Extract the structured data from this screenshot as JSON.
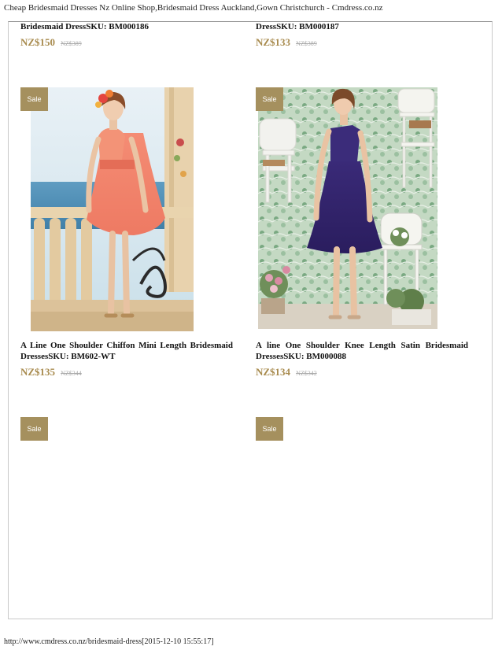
{
  "print": {
    "header_title": "Cheap Bridesmaid Dresses Nz Online Shop,Bridesmaid Dress Auckland,Gown Christchurch - Cmdress.co.nz",
    "footer_url": "http://www.cmdress.co.nz/bridesmaid-dress[2015-12-10 15:55:17]"
  },
  "products_top": [
    {
      "title": "Bridesmaid DressSKU: BM000186",
      "price": "NZ$150",
      "old_price": "NZ$389"
    },
    {
      "title": "DressSKU: BM000187",
      "price": "NZ$133",
      "old_price": "NZ$389"
    }
  ],
  "products_mid": [
    {
      "badge": "Sale",
      "image_alt": "Coral one shoulder chiffon mini dress",
      "title": "A Line One Shoulder Chiffon Mini Length Bridesmaid DressesSKU: BM602-WT",
      "price": "NZ$135",
      "old_price": "NZ$344"
    },
    {
      "badge": "Sale",
      "image_alt": "Purple one shoulder satin knee length dress",
      "title": "A line One Shoulder Knee Length Satin Bridesmaid DressesSKU: BM000088",
      "price": "NZ$134",
      "old_price": "NZ$342"
    }
  ],
  "products_bottom": [
    {
      "badge": "Sale"
    },
    {
      "badge": "Sale"
    }
  ],
  "colors": {
    "price": "#a88b4e",
    "badge": "#a5905e"
  }
}
